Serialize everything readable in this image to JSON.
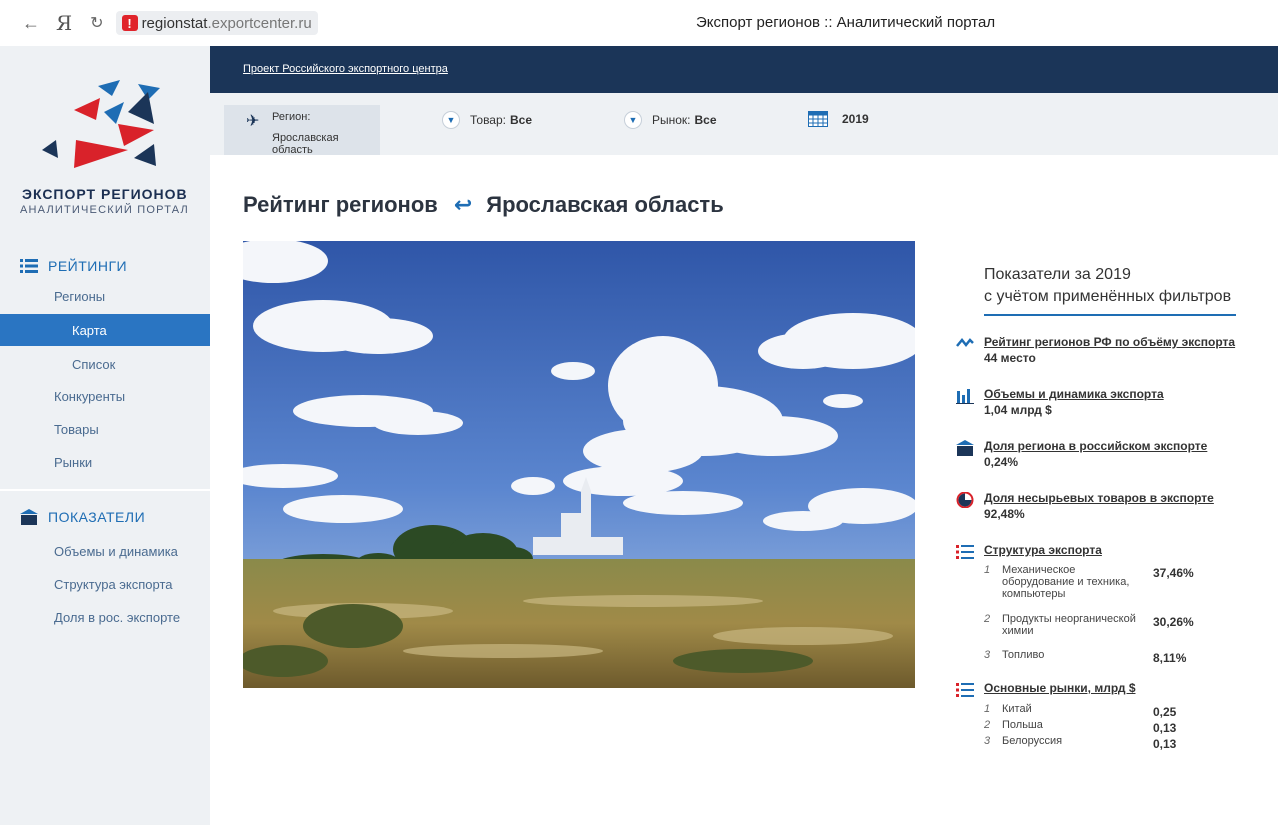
{
  "browser": {
    "back": "←",
    "ya": "Я",
    "reload": "↻",
    "url_host": "regionstat",
    "url_rest": ".exportcenter.ru",
    "title": "Экспорт регионов :: Аналитический портал"
  },
  "sidebar": {
    "brand_title": "ЭКСПОРТ РЕГИОНОВ",
    "brand_subtitle": "АНАЛИТИЧЕСКИЙ ПОРТАЛ",
    "ratings_head": "РЕЙТИНГИ",
    "ratings_items": [
      {
        "label": "Регионы"
      },
      {
        "label": "Карта"
      },
      {
        "label": "Список"
      },
      {
        "label": "Конкуренты"
      },
      {
        "label": "Товары"
      },
      {
        "label": "Рынки"
      }
    ],
    "indicators_head": "ПОКАЗАТЕЛИ",
    "indicator_items": [
      {
        "label": "Объемы и динамика"
      },
      {
        "label": "Структура экспорта"
      },
      {
        "label": "Доля в рос. экспорте"
      }
    ]
  },
  "topbar": {
    "project_link": "Проект Российского экспортного центра"
  },
  "filters": {
    "region_label": "Регион:",
    "region_value": "Ярославская область",
    "product_label": "Товар:",
    "product_value": "Все",
    "market_label": "Рынок:",
    "market_value": "Все",
    "year": "2019"
  },
  "main": {
    "heading": "Рейтинг регионов",
    "back_icon": "↩",
    "region": "Ярославская область"
  },
  "indicators": {
    "title_line1": "Показатели за 2019",
    "title_line2": "с учётом применённых фильтров",
    "rating_title": "Рейтинг регионов РФ по объёму экспорта",
    "rating_value": "44 место",
    "volume_title": "Объемы и динамика экспорта",
    "volume_value": "1,04 млрд $",
    "share_title": "Доля региона в российском экспорте",
    "share_value": "0,24%",
    "nonraw_title": "Доля несырьевых товаров в экспорте",
    "nonraw_value": "92,48%",
    "structure_title": "Структура экспорта",
    "structure": [
      {
        "n": "1",
        "name": "Механическое оборудование и техника, компьютеры",
        "value": "37,46%"
      },
      {
        "n": "2",
        "name": "Продукты неорганической химии",
        "value": "30,26%"
      },
      {
        "n": "3",
        "name": "Топливо",
        "value": "8,11%"
      }
    ],
    "markets_title": "Основные рынки, млрд $",
    "markets": [
      {
        "n": "1",
        "name": "Китай",
        "value": "0,25"
      },
      {
        "n": "2",
        "name": "Польша",
        "value": "0,13"
      },
      {
        "n": "3",
        "name": "Белоруссия",
        "value": "0,13"
      }
    ]
  },
  "colors": {
    "navy": "#1b3558",
    "accent": "#1e6db4",
    "active": "#2a75c2",
    "red": "#e0242b"
  }
}
